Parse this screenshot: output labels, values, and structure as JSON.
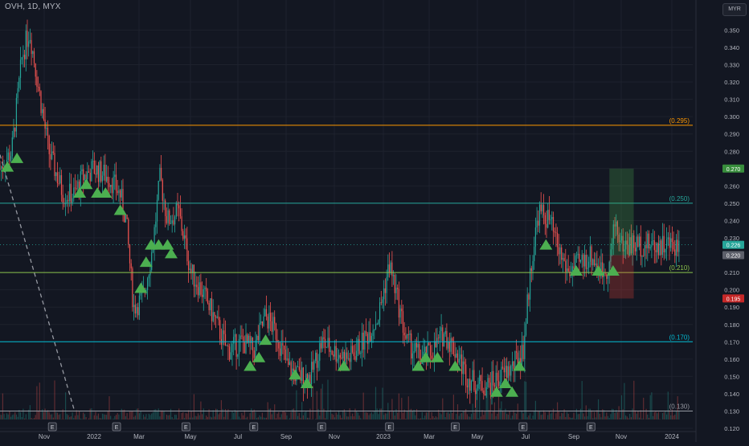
{
  "header": {
    "symbol_line": "OVH, 1D, MYX",
    "currency": "MYR"
  },
  "colors": {
    "background": "#131722",
    "grid": "#1e222d",
    "axis_text": "#b2b5be",
    "up": "#26a69a",
    "down": "#ef5350",
    "marker": "#4caf50",
    "level_orange": "#ff9800",
    "level_teal": "#26a69a",
    "level_green": "#8bc34a",
    "level_cyan": "#00bcd4",
    "level_gray": "#9598a1"
  },
  "chart_data": {
    "type": "candlestick",
    "x_ticks": [
      "Nov",
      "2022",
      "Mar",
      "May",
      "Jul",
      "Sep",
      "Nov",
      "2023",
      "Mar",
      "May",
      "Jul",
      "Sep",
      "Nov",
      "2024"
    ],
    "y_ticks": [
      "0.350",
      "0.340",
      "0.330",
      "0.320",
      "0.310",
      "0.300",
      "0.290",
      "0.280",
      "0.270",
      "0.260",
      "0.250",
      "0.240",
      "0.230",
      "0.220",
      "0.210",
      "0.200",
      "0.190",
      "0.180",
      "0.170",
      "0.160",
      "0.150",
      "0.140",
      "0.130",
      "0.120"
    ],
    "ylim": [
      0.118,
      0.356
    ],
    "price_path": [
      [
        "2021-09-15",
        0.27
      ],
      [
        "2021-10-01",
        0.28
      ],
      [
        "2021-10-15",
        0.335
      ],
      [
        "2021-10-25",
        0.35
      ],
      [
        "2021-11-05",
        0.32
      ],
      [
        "2021-11-20",
        0.28
      ],
      [
        "2021-12-10",
        0.255
      ],
      [
        "2021-12-25",
        0.255
      ],
      [
        "2022-01-05",
        0.265
      ],
      [
        "2022-01-20",
        0.27
      ],
      [
        "2022-02-10",
        0.265
      ],
      [
        "2022-02-25",
        0.255
      ],
      [
        "2022-03-05",
        0.24
      ],
      [
        "2022-03-15",
        0.19
      ],
      [
        "2022-03-28",
        0.195
      ],
      [
        "2022-04-10",
        0.225
      ],
      [
        "2022-04-20",
        0.265
      ],
      [
        "2022-04-30",
        0.24
      ],
      [
        "2022-05-15",
        0.245
      ],
      [
        "2022-06-01",
        0.21
      ],
      [
        "2022-06-15",
        0.2
      ],
      [
        "2022-07-01",
        0.185
      ],
      [
        "2022-07-20",
        0.165
      ],
      [
        "2022-08-10",
        0.17
      ],
      [
        "2022-08-25",
        0.165
      ],
      [
        "2022-09-10",
        0.185
      ],
      [
        "2022-09-25",
        0.175
      ],
      [
        "2022-10-10",
        0.155
      ],
      [
        "2022-10-25",
        0.15
      ],
      [
        "2022-11-10",
        0.15
      ],
      [
        "2022-11-25",
        0.17
      ],
      [
        "2022-12-10",
        0.165
      ],
      [
        "2023-01-01",
        0.16
      ],
      [
        "2023-01-20",
        0.17
      ],
      [
        "2023-02-10",
        0.185
      ],
      [
        "2023-02-25",
        0.215
      ],
      [
        "2023-03-05",
        0.2
      ],
      [
        "2023-03-20",
        0.17
      ],
      [
        "2023-04-10",
        0.16
      ],
      [
        "2023-04-25",
        0.165
      ],
      [
        "2023-05-10",
        0.175
      ],
      [
        "2023-05-25",
        0.165
      ],
      [
        "2023-06-10",
        0.15
      ],
      [
        "2023-06-25",
        0.145
      ],
      [
        "2023-07-10",
        0.145
      ],
      [
        "2023-07-25",
        0.15
      ],
      [
        "2023-08-10",
        0.155
      ],
      [
        "2023-08-25",
        0.165
      ],
      [
        "2023-09-05",
        0.215
      ],
      [
        "2023-09-15",
        0.245
      ],
      [
        "2023-09-30",
        0.24
      ],
      [
        "2023-10-10",
        0.225
      ],
      [
        "2023-10-25",
        0.21
      ],
      [
        "2023-11-10",
        0.215
      ],
      [
        "2023-11-25",
        0.22
      ],
      [
        "2023-12-10",
        0.21
      ],
      [
        "2023-12-20",
        0.215
      ],
      [
        "2023-12-28",
        0.24
      ],
      [
        "2024-01-05",
        0.226
      ]
    ],
    "horizontal_levels": [
      {
        "value": 0.295,
        "label": "(0.295)",
        "color": "#ff9800"
      },
      {
        "value": 0.25,
        "label": "(0.250)",
        "color": "#26a69a"
      },
      {
        "value": 0.21,
        "label": "(0.210)",
        "color": "#8bc34a"
      },
      {
        "value": 0.17,
        "label": "(0.170)",
        "color": "#00bcd4"
      },
      {
        "value": 0.13,
        "label": "(0.130)",
        "color": "#9598a1"
      }
    ],
    "price_tags": [
      {
        "value": 0.27,
        "text": "0.270",
        "bg": "#388e3c"
      },
      {
        "value": 0.226,
        "text": "0.226",
        "bg": "#26a69a"
      },
      {
        "value": 0.22,
        "text": "0.220",
        "bg": "#5d606b"
      },
      {
        "value": 0.195,
        "text": "0.195",
        "bg": "#c62828"
      }
    ],
    "position_box": {
      "from": "2023-12-20",
      "to": "2024-01-22",
      "entry": 0.22,
      "target": 0.27,
      "stop": 0.195
    },
    "trend_line": {
      "from": [
        "2021-09-15",
        0.278
      ],
      "to": [
        "2021-12-25",
        0.13
      ],
      "style": "dashed"
    },
    "markers": [
      [
        "2021-09-25",
        0.271
      ],
      [
        "2021-10-08",
        0.276
      ],
      [
        "2022-01-01",
        0.256
      ],
      [
        "2022-01-10",
        0.261
      ],
      [
        "2022-01-25",
        0.256
      ],
      [
        "2022-02-05",
        0.256
      ],
      [
        "2022-02-25",
        0.246
      ],
      [
        "2022-03-25",
        0.201
      ],
      [
        "2022-04-01",
        0.216
      ],
      [
        "2022-04-08",
        0.226
      ],
      [
        "2022-04-18",
        0.226
      ],
      [
        "2022-04-30",
        0.226
      ],
      [
        "2022-05-05",
        0.221
      ],
      [
        "2022-08-20",
        0.156
      ],
      [
        "2022-09-01",
        0.161
      ],
      [
        "2022-09-10",
        0.171
      ],
      [
        "2022-10-20",
        0.151
      ],
      [
        "2022-11-05",
        0.146
      ],
      [
        "2022-12-25",
        0.156
      ],
      [
        "2023-04-05",
        0.156
      ],
      [
        "2023-04-15",
        0.161
      ],
      [
        "2023-05-01",
        0.161
      ],
      [
        "2023-05-25",
        0.156
      ],
      [
        "2023-07-20",
        0.141
      ],
      [
        "2023-08-01",
        0.146
      ],
      [
        "2023-08-10",
        0.141
      ],
      [
        "2023-08-20",
        0.156
      ],
      [
        "2023-09-25",
        0.226
      ],
      [
        "2023-11-05",
        0.211
      ],
      [
        "2023-12-05",
        0.211
      ],
      [
        "2023-12-25",
        0.211
      ]
    ],
    "earnings_dates": [
      "2021-11-25",
      "2022-02-20",
      "2022-05-25",
      "2022-08-25",
      "2022-11-25",
      "2023-02-25",
      "2023-05-25",
      "2023-08-25",
      "2023-11-25"
    ],
    "earnings_label": "E"
  }
}
